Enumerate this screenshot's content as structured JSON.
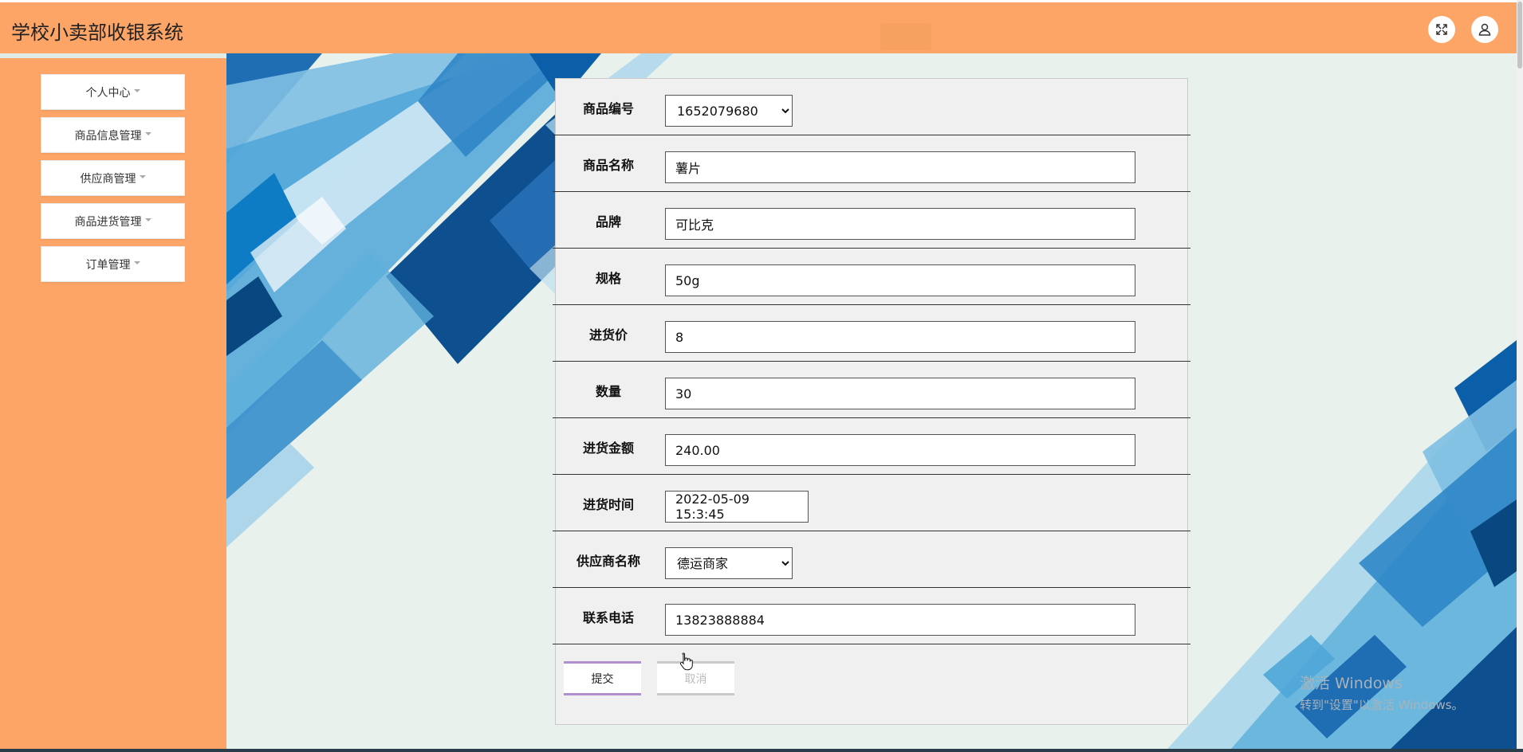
{
  "app": {
    "title": "学校小卖部收银系统"
  },
  "header": {
    "fullscreen_icon": "expand-icon",
    "user_icon": "user-icon"
  },
  "sidebar": {
    "items": [
      {
        "label": "个人中心"
      },
      {
        "label": "商品信息管理"
      },
      {
        "label": "供应商管理"
      },
      {
        "label": "商品进货管理"
      },
      {
        "label": "订单管理"
      }
    ]
  },
  "form": {
    "product_code": {
      "label": "商品编号",
      "value": "1652079680"
    },
    "product_name": {
      "label": "商品名称",
      "value": "薯片"
    },
    "brand": {
      "label": "品牌",
      "value": "可比克"
    },
    "spec": {
      "label": "规格",
      "value": "50g"
    },
    "purchase_price": {
      "label": "进货价",
      "value": "8"
    },
    "quantity": {
      "label": "数量",
      "value": "30"
    },
    "purchase_amount": {
      "label": "进货金额",
      "value": "240.00"
    },
    "purchase_time": {
      "label": "进货时间",
      "value": "2022-05-09 15:3:45"
    },
    "supplier_name": {
      "label": "供应商名称",
      "value": "德运商家"
    },
    "contact_phone": {
      "label": "联系电话",
      "value": "13823888884"
    },
    "submit_label": "提交",
    "cancel_label": "取消"
  },
  "watermark": {
    "line1": "激活 Windows",
    "line2": "转到\"设置\"以激活 Windows。"
  },
  "colors": {
    "header_bg": "#fca566",
    "main_bg": "#e8f1ec",
    "submit_accent": "#b28fcf"
  }
}
